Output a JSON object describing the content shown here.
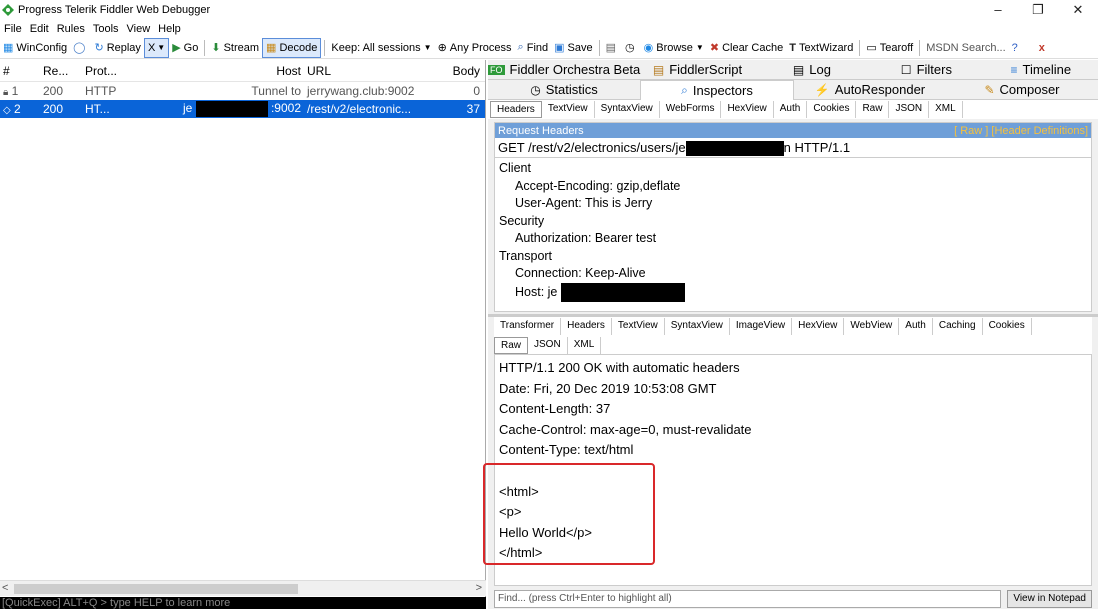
{
  "window": {
    "title": "Progress Telerik Fiddler Web Debugger",
    "minimize": "–",
    "restore": "❐",
    "close": "✕"
  },
  "menu": [
    "File",
    "Edit",
    "Rules",
    "Tools",
    "View",
    "Help"
  ],
  "toolbar": {
    "winconfig": "WinConfig",
    "replay": "Replay",
    "x": "X",
    "go": "Go",
    "stream": "Stream",
    "decode": "Decode",
    "keep": "Keep: All sessions",
    "process": "Any Process",
    "find": "Find",
    "save": "Save",
    "browse": "Browse",
    "clear_cache": "Clear Cache",
    "textwizard": "TextWizard",
    "tearoff": "Tearoff",
    "msdn_search": "MSDN Search...",
    "close": "x"
  },
  "sessions": {
    "columns": [
      "#",
      "Re...",
      "Prot...",
      "Host",
      "URL",
      "Body"
    ],
    "rows": [
      {
        "num": "1",
        "result": "200",
        "protocol": "HTTP",
        "host": "Tunnel to",
        "url": "jerrywang.club:9002",
        "body": "0"
      },
      {
        "num": "2",
        "result": "200",
        "protocol": "HT...",
        "host_prefix": "je",
        "host_suffix": ":9002",
        "url": "/rest/v2/electronic...",
        "body": "37"
      }
    ],
    "quickexec": "[QuickExec] ALT+Q > type HELP to learn more"
  },
  "top_tabs_row1": [
    "Fiddler Orchestra Beta",
    "FiddlerScript",
    "Log",
    "Filters",
    "Timeline"
  ],
  "top_tabs_row2": [
    "Statistics",
    "Inspectors",
    "AutoResponder",
    "Composer"
  ],
  "request_tabs": [
    "Headers",
    "TextView",
    "SyntaxView",
    "WebForms",
    "HexView",
    "Auth",
    "Cookies",
    "Raw",
    "JSON",
    "XML"
  ],
  "request": {
    "header_label": "Request Headers",
    "links": "[ Raw ]  [Header Definitions]",
    "line_prefix": "GET /rest/v2/electronics/users/je",
    "line_suffix": "n HTTP/1.1",
    "groups": [
      {
        "name": "Client",
        "items": [
          "Accept-Encoding: gzip,deflate",
          "User-Agent: This is Jerry"
        ]
      },
      {
        "name": "Security",
        "items": [
          "Authorization: Bearer test"
        ]
      },
      {
        "name": "Transport",
        "items": [
          "Connection: Keep-Alive",
          "Host: je"
        ]
      }
    ]
  },
  "response_tabs_row1": [
    "Transformer",
    "Headers",
    "TextView",
    "SyntaxView",
    "ImageView",
    "HexView",
    "WebView",
    "Auth",
    "Caching",
    "Cookies"
  ],
  "response_tabs_row2": [
    "Raw",
    "JSON",
    "XML"
  ],
  "response": {
    "lines": [
      "HTTP/1.1 200 OK with automatic headers",
      "Date: Fri, 20 Dec 2019 10:53:08 GMT",
      "Content-Length: 37",
      "Cache-Control: max-age=0, must-revalidate",
      "Content-Type: text/html",
      "",
      "<html>",
      "<p>",
      "Hello World</p>",
      "</html>"
    ]
  },
  "findbar": {
    "placeholder": "Find... (press Ctrl+Enter to highlight all)",
    "button": "View in Notepad"
  },
  "colors": {
    "selection": "#0a64d8",
    "header_bar": "#6f9fd8",
    "highlight": "#d9282a"
  }
}
